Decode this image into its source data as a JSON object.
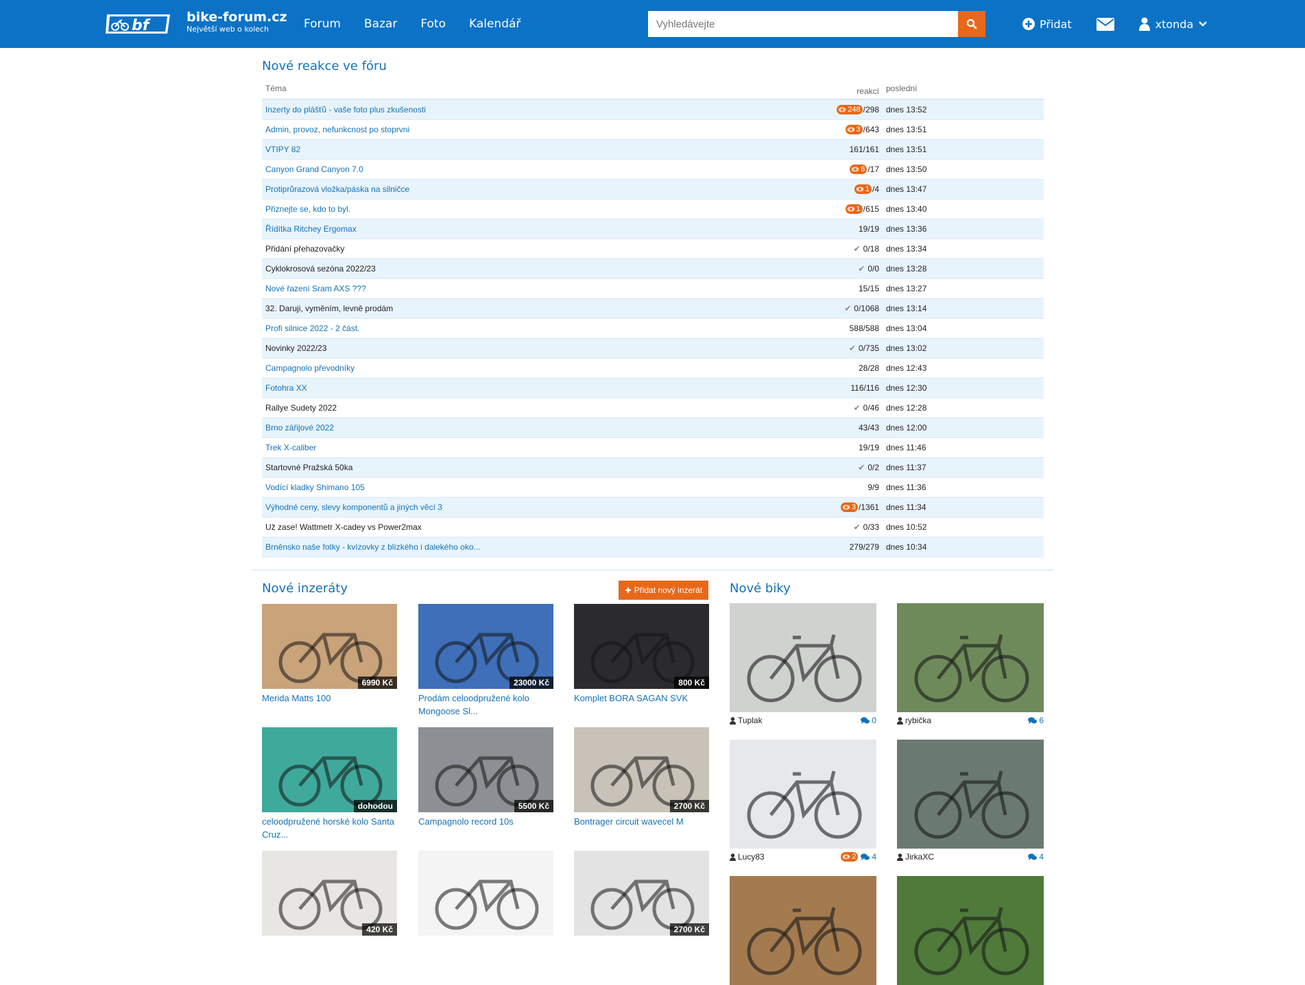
{
  "header": {
    "logo_name": "bike-forum.cz",
    "logo_tagline": "Největší web o kolech",
    "nav": [
      "Forum",
      "Bazar",
      "Foto",
      "Kalendář"
    ],
    "search_placeholder": "Vyhledávejte",
    "add_label": "Přidat",
    "username": "xtonda",
    "icons": [
      "search-icon",
      "plus-circle-icon",
      "envelope-icon",
      "user-icon",
      "chevron-down-icon"
    ]
  },
  "forum": {
    "title": "Nové reakce ve fóru",
    "col_topic": "Téma",
    "col_reactions": "reakcí",
    "col_last": "poslední",
    "rows": [
      {
        "topic": "Inzerty do plášťů - vaše foto plus zkušenosti",
        "unread": "248",
        "count": "/298",
        "last": "dnes 13:52",
        "link": true,
        "check": false
      },
      {
        "topic": "Admin, provoz, nefunkcnost po stoprvni",
        "unread": "3",
        "count": "/643",
        "last": "dnes 13:51",
        "link": true,
        "check": false
      },
      {
        "topic": "VTIPY 82",
        "unread": "",
        "count": "161/161",
        "last": "dnes 13:51",
        "link": true,
        "check": false
      },
      {
        "topic": "Canyon Grand Canyon 7.0",
        "unread": "6",
        "count": "/17",
        "last": "dnes 13:50",
        "link": true,
        "check": false
      },
      {
        "topic": "Protiprůrazová vložka/páska na silničce",
        "unread": "1",
        "count": "/4",
        "last": "dnes 13:47",
        "link": true,
        "check": false
      },
      {
        "topic": "Přiznejte se, kdo to byl.",
        "unread": "1",
        "count": "/615",
        "last": "dnes 13:40",
        "link": true,
        "check": false
      },
      {
        "topic": "Řídítka Ritchey Ergomax",
        "unread": "",
        "count": "19/19",
        "last": "dnes 13:36",
        "link": true,
        "check": false
      },
      {
        "topic": "Přidání přehazovačky",
        "unread": "",
        "count": "0/18",
        "last": "dnes 13:34",
        "link": false,
        "check": true
      },
      {
        "topic": "Cyklokrosová sezóna 2022/23",
        "unread": "",
        "count": "0/0",
        "last": "dnes 13:28",
        "link": false,
        "check": true
      },
      {
        "topic": "Nové řazení Sram AXS ???",
        "unread": "",
        "count": "15/15",
        "last": "dnes 13:27",
        "link": true,
        "check": false
      },
      {
        "topic": "32. Daruji, vyměním, levně prodám",
        "unread": "",
        "count": "0/1068",
        "last": "dnes 13:14",
        "link": false,
        "check": true
      },
      {
        "topic": "Profi silnice 2022 - 2 část.",
        "unread": "",
        "count": "588/588",
        "last": "dnes 13:04",
        "link": true,
        "check": false
      },
      {
        "topic": "Novinky 2022/23",
        "unread": "",
        "count": "0/735",
        "last": "dnes 13:02",
        "link": false,
        "check": true
      },
      {
        "topic": "Campagnolo převodníky",
        "unread": "",
        "count": "28/28",
        "last": "dnes 12:43",
        "link": true,
        "check": false
      },
      {
        "topic": "Fotohra XX",
        "unread": "",
        "count": "116/116",
        "last": "dnes 12:30",
        "link": true,
        "check": false
      },
      {
        "topic": "Rallye Sudety 2022",
        "unread": "",
        "count": "0/46",
        "last": "dnes 12:28",
        "link": false,
        "check": true
      },
      {
        "topic": "Brno zářijové 2022",
        "unread": "",
        "count": "43/43",
        "last": "dnes 12:00",
        "link": true,
        "check": false
      },
      {
        "topic": "Trek X-caliber",
        "unread": "",
        "count": "19/19",
        "last": "dnes 11:46",
        "link": true,
        "check": false
      },
      {
        "topic": "Startovné Pražská 50ka",
        "unread": "",
        "count": "0/2",
        "last": "dnes 11:37",
        "link": false,
        "check": true
      },
      {
        "topic": "Vodící kladky Shimano 105",
        "unread": "",
        "count": "9/9",
        "last": "dnes 11:36",
        "link": true,
        "check": false
      },
      {
        "topic": "Výhodné ceny, slevy komponentů a jiných věcí 3",
        "unread": "3",
        "count": "/1361",
        "last": "dnes 11:34",
        "link": true,
        "check": false
      },
      {
        "topic": "Už zase! Wattmetr X-cadey vs Power2max",
        "unread": "",
        "count": "0/33",
        "last": "dnes 10:52",
        "link": false,
        "check": true
      },
      {
        "topic": "Brněnsko naše fotky - kvízovky z blízkého i dalekého oko...",
        "unread": "",
        "count": "279/279",
        "last": "dnes 10:34",
        "link": true,
        "check": false
      }
    ]
  },
  "ads": {
    "title": "Nové inzeráty",
    "add_button": "Přidat nový inzerát",
    "items": [
      {
        "title": "Merida Matts 100",
        "price": "6990 Kč",
        "bg": "#c9a37a"
      },
      {
        "title": "Prodám celoodpružené kolo Mongoose Sl...",
        "price": "23000 Kč",
        "bg": "#3f6fb8"
      },
      {
        "title": "Komplet BORA SAGAN SVK",
        "price": "800 Kč",
        "bg": "#2b2b2f"
      },
      {
        "title": "celoodpružené horské kolo Santa Cruz...",
        "price": "dohodou",
        "bg": "#3fa99c"
      },
      {
        "title": "Campagnolo record 10s",
        "price": "5500 Kč",
        "bg": "#8c8f93"
      },
      {
        "title": "Bontrager circuit wavecel M",
        "price": "2700 Kč",
        "bg": "#c8c2b8"
      },
      {
        "title": "",
        "price": "420 Kč",
        "bg": "#e8e6e2"
      },
      {
        "title": "",
        "price": "",
        "bg": "#f4f4f4"
      },
      {
        "title": "",
        "price": "2700 Kč",
        "bg": "#e3e3e3"
      }
    ]
  },
  "bikes": {
    "title": "Nové biky",
    "items": [
      {
        "user": "Tuplak",
        "comments": "0",
        "unread": "",
        "bg": "#cfd2cf"
      },
      {
        "user": "rybička",
        "comments": "6",
        "unread": "",
        "bg": "#6f8a5a"
      },
      {
        "user": "Lucy83",
        "comments": "4",
        "unread": "2",
        "bg": "#e6e8ec"
      },
      {
        "user": "JirkaXC",
        "comments": "4",
        "unread": "",
        "bg": "#6a7a70"
      },
      {
        "user": "",
        "comments": "",
        "unread": "",
        "bg": "#a47a4f"
      },
      {
        "user": "",
        "comments": "",
        "unread": "",
        "bg": "#4f7a3a"
      }
    ]
  }
}
